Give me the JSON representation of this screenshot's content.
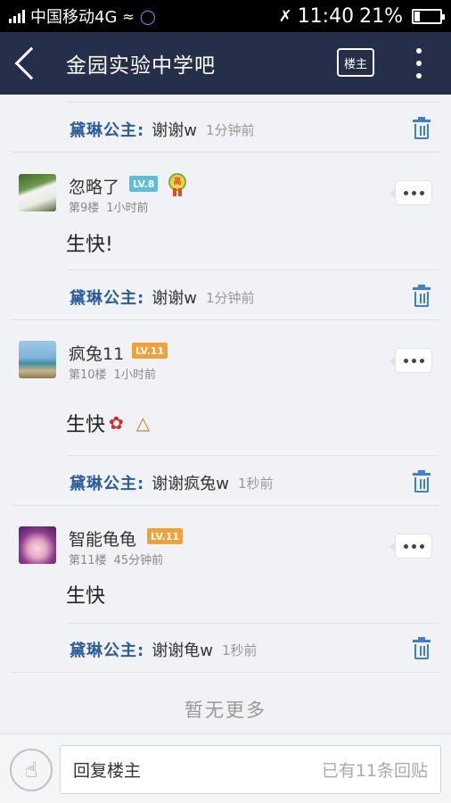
{
  "status_bar": {
    "carrier": "中国移动4G",
    "time": "11:40",
    "battery_pct": "21%"
  },
  "header": {
    "title": "金园实验中学吧",
    "louzhu_label": "楼主"
  },
  "replies": [
    {
      "name": "黛琳公主:",
      "text": "谢谢w",
      "time": "1分钟前"
    },
    {
      "name": "黛琳公主:",
      "text": "谢谢w",
      "time": "1分钟前"
    },
    {
      "name": "黛琳公主:",
      "text": "谢谢疯兔w",
      "time": "1秒前"
    },
    {
      "name": "黛琳公主:",
      "text": "谢谢龟w",
      "time": "1秒前"
    }
  ],
  "posts": [
    {
      "username": "忽略了",
      "level": "LV.8",
      "floor": "第9楼",
      "time": "1小时前",
      "text": "生快!",
      "badge": "高"
    },
    {
      "username": "疯兔11",
      "level": "LV.11",
      "floor": "第10楼",
      "time": "1小时前",
      "text": "生快"
    },
    {
      "username": "智能龟龟",
      "level": "LV.11",
      "floor": "第11楼",
      "time": "45分钟前",
      "text": "生快"
    }
  ],
  "icons": {
    "rose": "rose-emoji-icon",
    "cake": "cake-emoji-icon"
  },
  "footer": {
    "no_more": "暂无更多",
    "reply_placeholder": "回复楼主",
    "reply_count": "已有11条回贴"
  },
  "colors": {
    "header_bg": "#262f4a",
    "reply_name": "#2b5c9c",
    "trash_icon": "#3d7fd1",
    "level_blue": "#5ac0d8",
    "level_orange": "#f0a23a"
  }
}
